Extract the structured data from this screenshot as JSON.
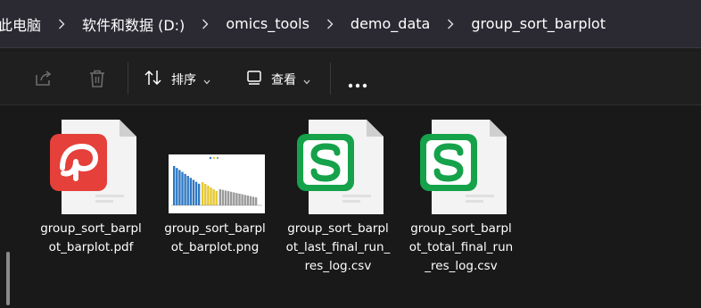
{
  "breadcrumb": {
    "items": [
      "此电脑",
      "软件和数据 (D:)",
      "omics_tools",
      "demo_data",
      "group_sort_barplot"
    ]
  },
  "toolbar": {
    "share_icon": "share-icon",
    "delete_icon": "trash-icon",
    "sort_label": "排序",
    "view_label": "查看",
    "more_icon": "more-icon"
  },
  "files": [
    {
      "name": "group_sort_barplot_barplot.pdf",
      "icon": "pdf-icon"
    },
    {
      "name": "group_sort_barplot_barplot.png",
      "icon": "image-thumbnail"
    },
    {
      "name": "group_sort_barplot_last_final_run_res_log.csv",
      "icon": "csv-icon"
    },
    {
      "name": "group_sort_barplot_total_final_run_res_log.csv",
      "icon": "csv-icon"
    }
  ],
  "colors": {
    "pdf_red": "#e5403a",
    "csv_green": "#15a24a",
    "bar_blue": "#2f78c4",
    "bar_yellow": "#e6c72e",
    "bar_gray": "#9a9a9a"
  }
}
